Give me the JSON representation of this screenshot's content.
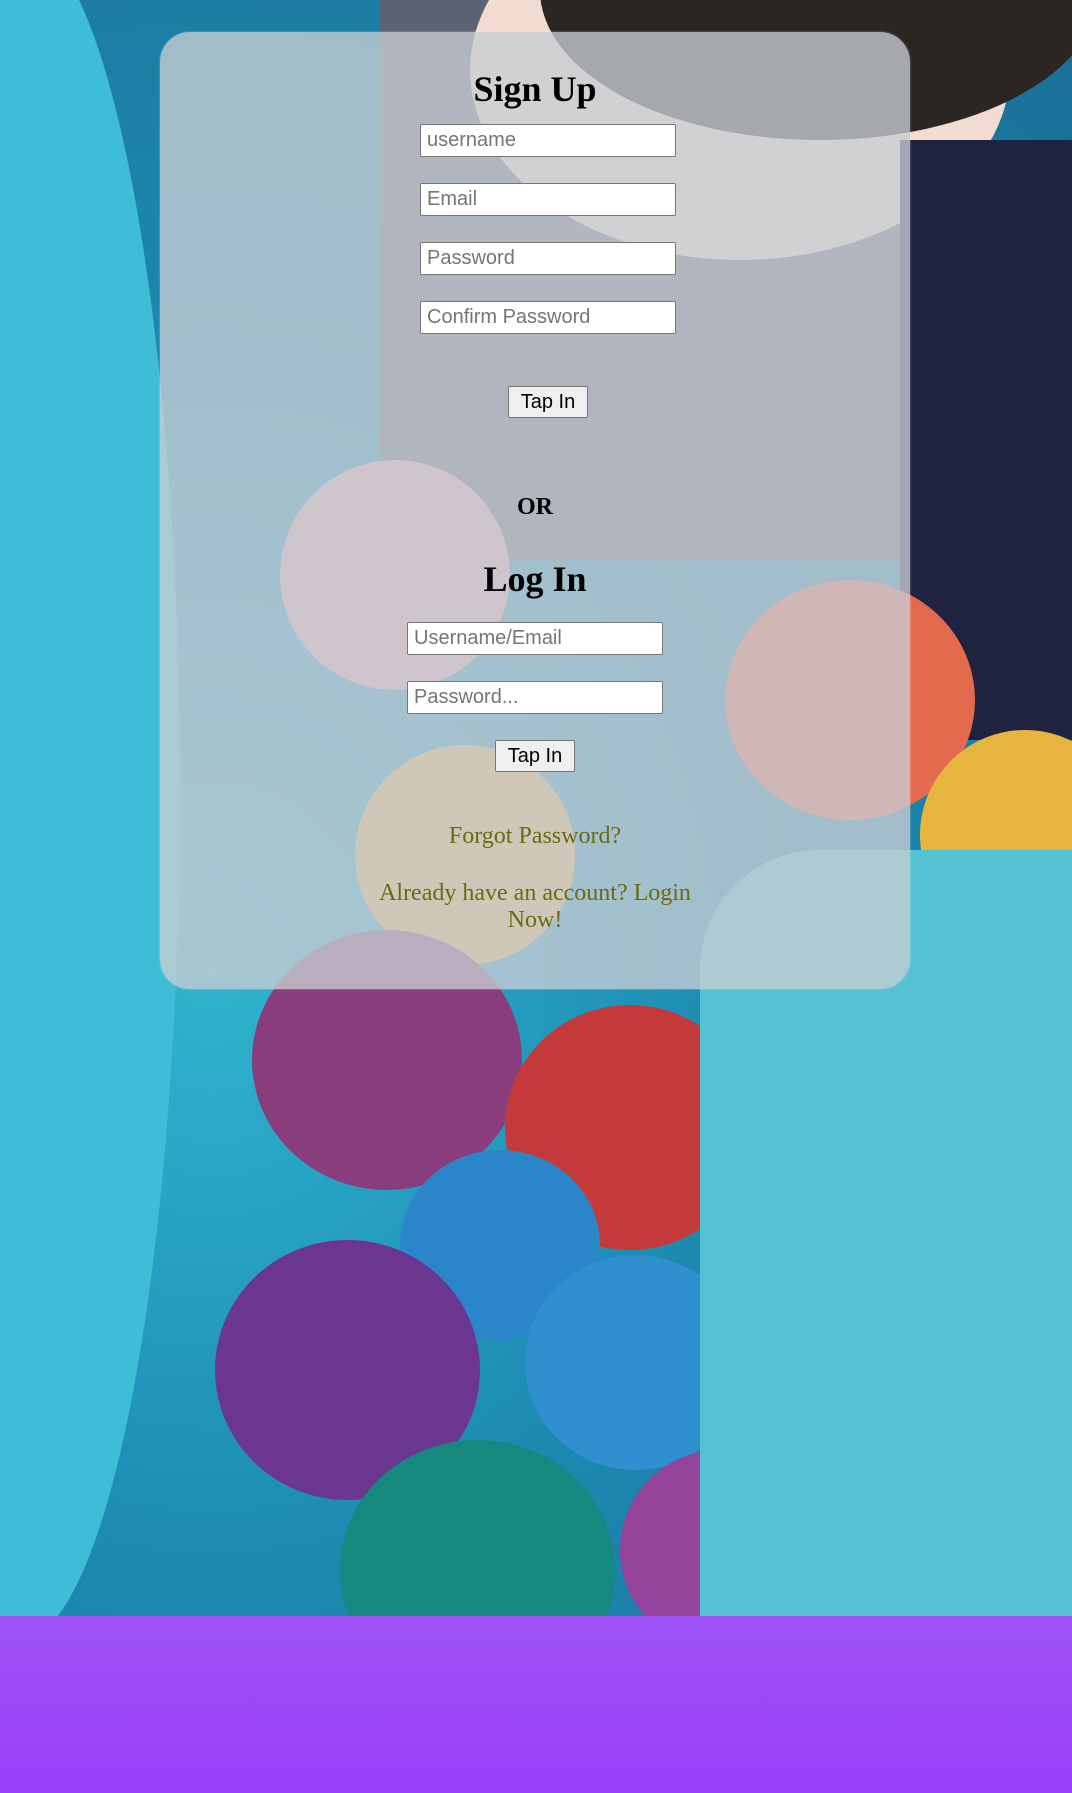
{
  "signup": {
    "title": "Sign Up",
    "username_placeholder": "username",
    "email_placeholder": "Email",
    "password_placeholder": "Password",
    "confirm_placeholder": "Confirm Password",
    "submit_label": "Tap In"
  },
  "divider": {
    "label": "OR"
  },
  "login": {
    "title": "Log In",
    "user_placeholder": "Username/Email",
    "password_placeholder": "Password...",
    "submit_label": "Tap In"
  },
  "links": {
    "forgot": "Forgot Password?",
    "have_account": "Already have an account? Login Now!"
  },
  "colors": {
    "link": "#6b6a12",
    "card": "rgba(200,205,212,0.78)",
    "footer_top": "#bccfe0",
    "footer_bottom": "#9a3ef8"
  }
}
